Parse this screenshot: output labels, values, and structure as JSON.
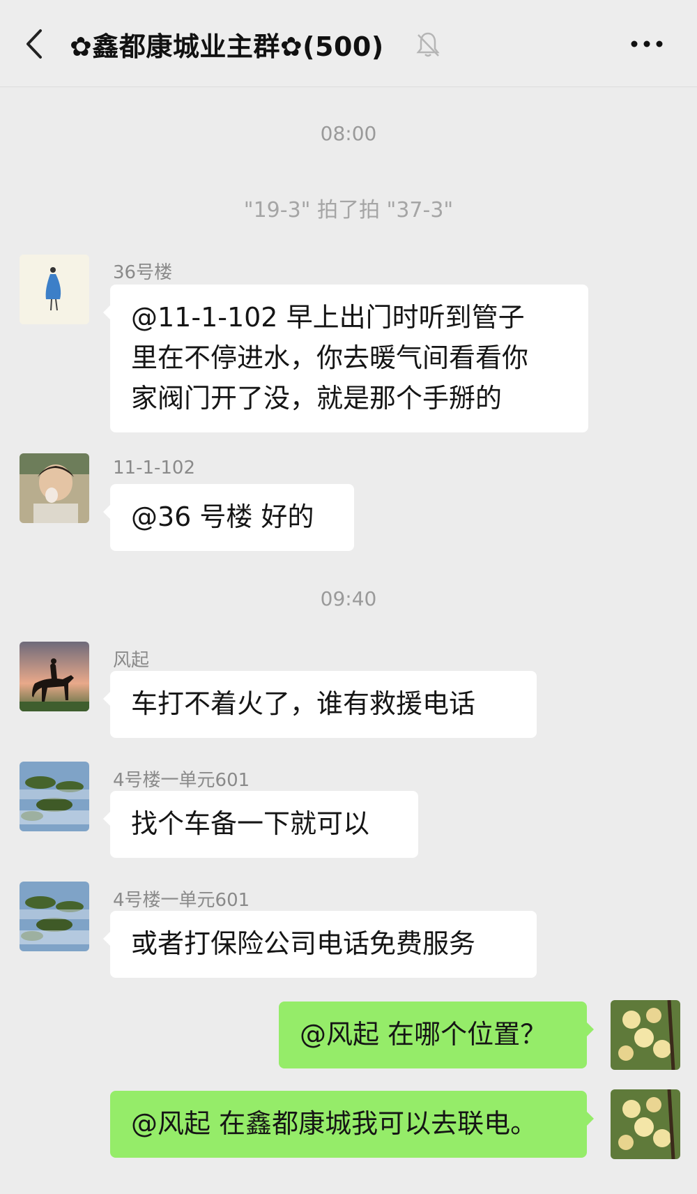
{
  "header": {
    "title": "✿鑫都康城业主群✿(500)",
    "back_icon": "chevron-left-icon",
    "mute_icon": "bell-off-icon",
    "more_icon": "more-dots-icon"
  },
  "colors": {
    "background": "#ececec",
    "bubble_received": "#ffffff",
    "bubble_sent": "#95ec69",
    "timestamp": "#9a9a9a"
  },
  "timestamps": [
    "08:00",
    "09:40"
  ],
  "system_message": "\"19-3\" 拍了拍 \"37-3\"",
  "messages": [
    {
      "sender": "36号楼",
      "lines": [
        "@11-1-102  早上出门时听到管子",
        "里在不停进水，你去暖气间看看你",
        "家阀门开了没，就是那个手掰的"
      ]
    },
    {
      "sender": "11-1-102",
      "lines": [
        "@36 号楼  好的"
      ]
    },
    {
      "sender": "风起",
      "lines": [
        "车打不着火了，谁有救援电话"
      ]
    },
    {
      "sender": "4号楼一单元601",
      "lines": [
        "找个车备一下就可以"
      ]
    },
    {
      "sender": "4号楼一单元601",
      "lines": [
        "或者打保险公司电话免费服务"
      ]
    },
    {
      "sender": "",
      "lines": [
        "@风起  在哪个位置？"
      ]
    },
    {
      "sender": "",
      "lines": [
        "@风起  在鑫都康城我可以去联电。"
      ]
    }
  ]
}
